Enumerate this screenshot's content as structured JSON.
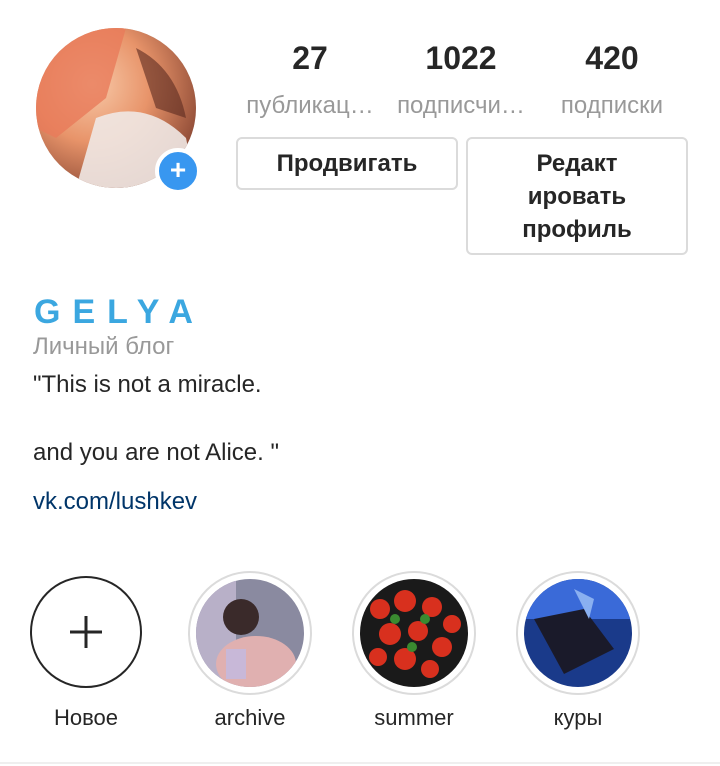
{
  "profile": {
    "stats": [
      {
        "value": "27",
        "label": "публикац…"
      },
      {
        "value": "1022",
        "label": "подписчи…"
      },
      {
        "value": "420",
        "label": "подписки"
      }
    ],
    "promote_label": "Продвигать",
    "edit_label": "Редакт\nировать\nпрофиль",
    "name": "GELYA",
    "category": "Личный блог",
    "bio": "\"This is not a miracle.\n\nand you are not Alice. \"",
    "link": "vk.com/lushkev"
  },
  "highlights": [
    {
      "label": "Новое",
      "icon": "plus-icon"
    },
    {
      "label": "archive"
    },
    {
      "label": "summer"
    },
    {
      "label": "куры"
    }
  ],
  "colors": {
    "accent": "#3897f0",
    "name": "#3ba7e0",
    "link": "#003569"
  }
}
